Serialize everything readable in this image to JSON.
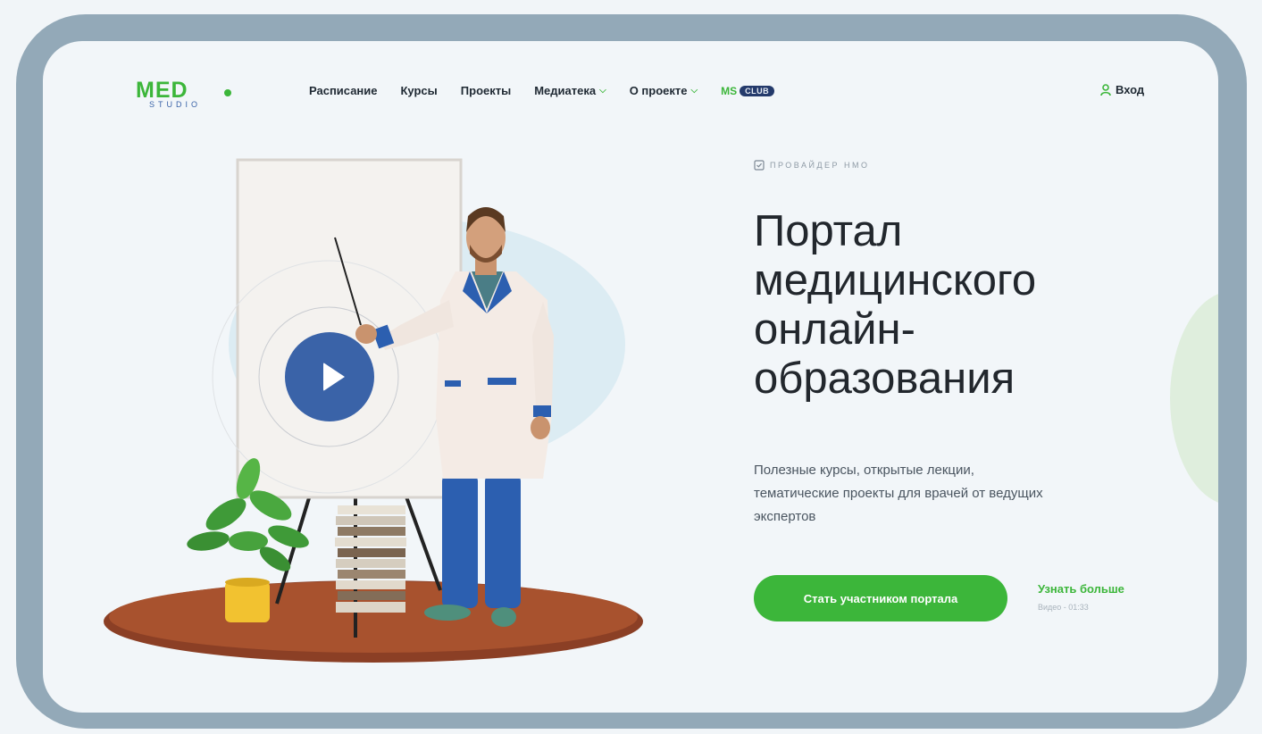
{
  "brand": {
    "logo_main": "MED",
    "logo_sub": "STUDIO"
  },
  "nav": {
    "items": [
      {
        "label": "Расписание",
        "dropdown": false
      },
      {
        "label": "Курсы",
        "dropdown": false
      },
      {
        "label": "Проекты",
        "dropdown": false
      },
      {
        "label": "Медиатека",
        "dropdown": true
      },
      {
        "label": "О проекте",
        "dropdown": true
      }
    ],
    "ms_club": {
      "prefix": "MS",
      "badge": "CLUB"
    },
    "login_label": "Вход",
    "icons": {
      "dropdown": "chevron-down-icon",
      "login": "user-icon"
    }
  },
  "hero": {
    "provider_label": "провайдер нмо",
    "title_lines": [
      "Портал",
      "медицинского",
      "онлайн-",
      "образования"
    ],
    "subtitle_lines": [
      "Полезные курсы, открытые лекции,",
      "тематические проекты для врачей от ведущих",
      "экспертов"
    ],
    "cta_label": "Стать участником портала",
    "more_label": "Узнать больше",
    "more_meta": "Видео - 01:33"
  },
  "colors": {
    "accent": "#3cb63a",
    "frame": "#93a9b8",
    "background": "#f2f6f9",
    "play": "#3a63a8",
    "text": "#22272d"
  }
}
